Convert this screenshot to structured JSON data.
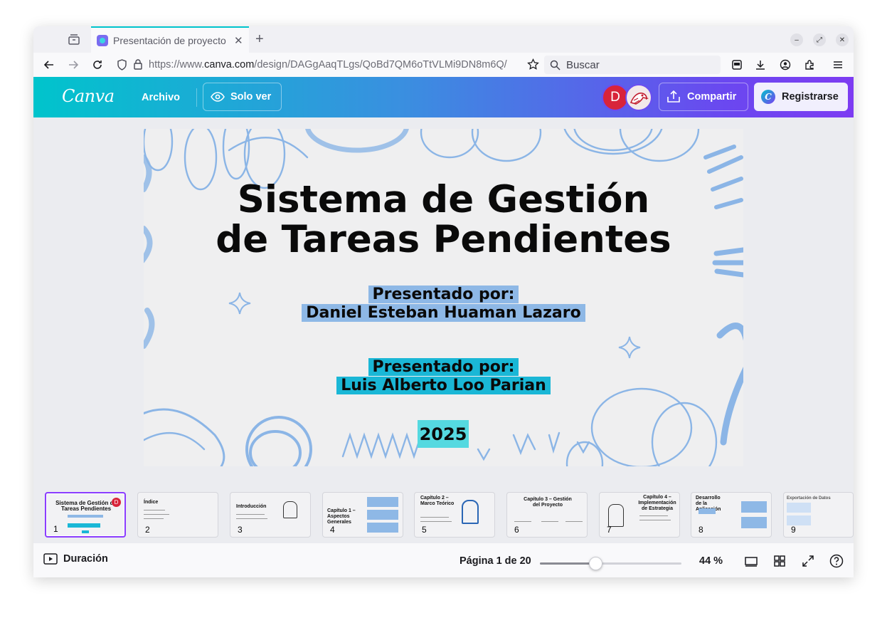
{
  "browser": {
    "tab_title": "Presentación de proyecto",
    "new_tab_symbol": "+",
    "url_prefix": "https://www.",
    "url_domain": "canva.com",
    "url_path": "/design/DAGgAaqTLgs/QoBd7QM6oTtVLMi9DN8m6Q/",
    "search_placeholder": "Buscar"
  },
  "canva": {
    "logo": "Canva",
    "file_menu": "Archivo",
    "view_mode": "Solo ver",
    "avatar_initial": "D",
    "share": "Compartir",
    "register": "Registrarse"
  },
  "slide": {
    "title_line1": "Sistema de Gestión",
    "title_line2": "de Tareas Pendientes",
    "presenter1_label": "Presentado por:",
    "presenter1_name": "Daniel Esteban Huaman Lazaro",
    "presenter2_label": "Presentado por:",
    "presenter2_name": "Luis Alberto Loo Parian",
    "year": "2025"
  },
  "thumbnails": [
    {
      "num": "1",
      "title": "Sistema de Gestión de Tareas Pendientes",
      "badge": "D"
    },
    {
      "num": "2",
      "title": "Índice"
    },
    {
      "num": "3",
      "title": "Introducción"
    },
    {
      "num": "4",
      "title": "Capítulo 1 – Aspectos Generales"
    },
    {
      "num": "5",
      "title": "Capítulo 2 – Marco Teórico"
    },
    {
      "num": "6",
      "title": "Capítulo 3 – Gestión del Proyecto"
    },
    {
      "num": "7",
      "title": "Capítulo 4 – Implementación de Estrategia"
    },
    {
      "num": "8",
      "title": "Desarrollo de la Aplicación"
    },
    {
      "num": "9",
      "title": "Exportación de Datos"
    }
  ],
  "footer": {
    "duration": "Duración",
    "page_label": "Página 1 de 20",
    "zoom": "44 %",
    "zoom_fraction": 0.39
  },
  "colors": {
    "accent": "#8b3dff",
    "presenter1_highlight": "#8eb8e6",
    "presenter2_highlight": "#1ab7d6",
    "year_highlight": "#55d9e0",
    "avatar": "#d8243a"
  }
}
